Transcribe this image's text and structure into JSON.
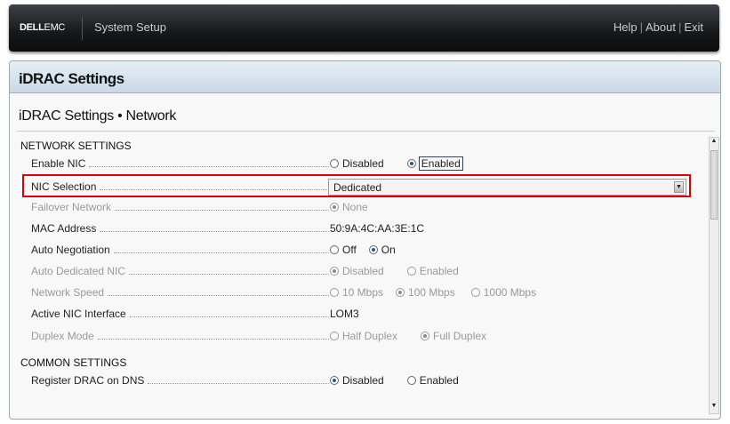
{
  "header": {
    "logo": "DELL",
    "logo_suffix": "EMC",
    "app_title": "System Setup",
    "links": [
      "Help",
      "About",
      "Exit"
    ]
  },
  "panel": {
    "title": "iDRAC Settings",
    "subtitle": "iDRAC Settings • Network"
  },
  "sections": {
    "network": "NETWORK SETTINGS",
    "common": "COMMON SETTINGS"
  },
  "rows": {
    "enable_nic": {
      "label": "Enable NIC",
      "options": [
        "Disabled",
        "Enabled"
      ],
      "selected": "Enabled"
    },
    "nic_selection": {
      "label": "NIC Selection",
      "value": "Dedicated"
    },
    "failover": {
      "label": "Failover Network",
      "options": [
        "None"
      ],
      "selected": "None"
    },
    "mac": {
      "label": "MAC Address",
      "value": "50:9A:4C:AA:3E:1C"
    },
    "auto_neg": {
      "label": "Auto Negotiation",
      "options": [
        "Off",
        "On"
      ],
      "selected": "On"
    },
    "auto_ded": {
      "label": "Auto Dedicated NIC",
      "options": [
        "Disabled",
        "Enabled"
      ],
      "selected": "Disabled"
    },
    "speed": {
      "label": "Network Speed",
      "options": [
        "10 Mbps",
        "100 Mbps",
        "1000 Mbps"
      ],
      "selected": "100 Mbps"
    },
    "active_nic": {
      "label": "Active NIC Interface",
      "value": "LOM3"
    },
    "duplex": {
      "label": "Duplex Mode",
      "options": [
        "Half Duplex",
        "Full Duplex"
      ],
      "selected": "Full Duplex"
    },
    "register_dns": {
      "label": "Register DRAC on DNS",
      "options": [
        "Disabled",
        "Enabled"
      ],
      "selected": "Disabled"
    }
  },
  "colors": {
    "highlight": "#dd0000",
    "radio_selected": "#2a4fa8"
  }
}
